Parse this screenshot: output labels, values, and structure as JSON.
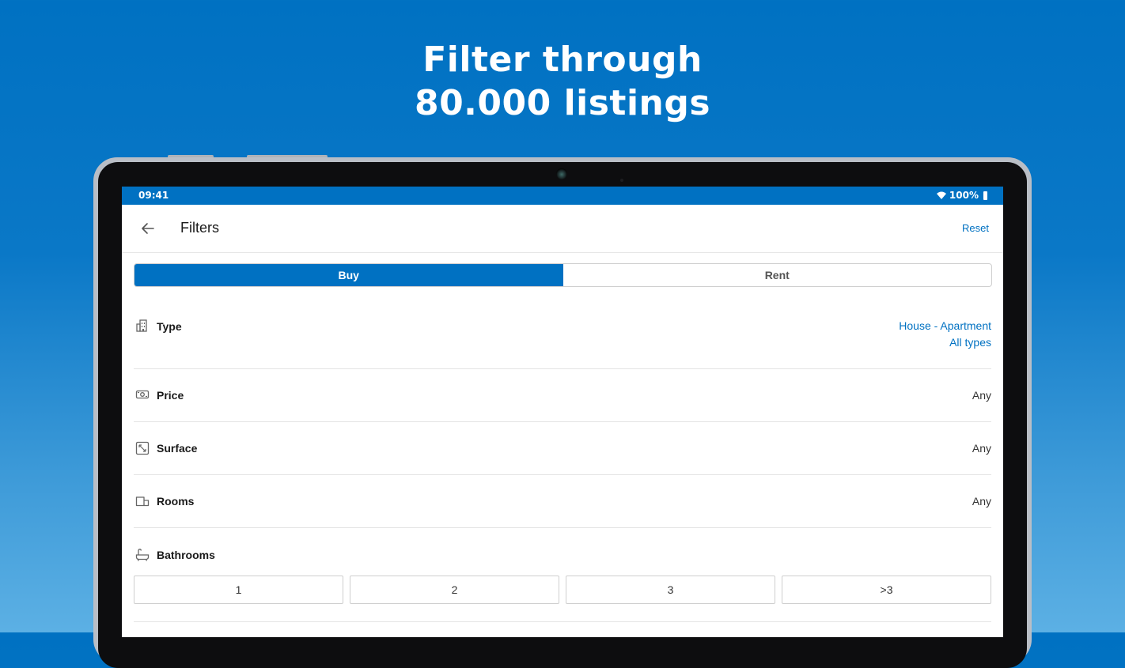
{
  "headline": {
    "line1": "Filter through",
    "line2": "80.000 listings"
  },
  "status_bar": {
    "time": "09:41",
    "battery": "100%"
  },
  "app_bar": {
    "title": "Filters",
    "reset": "Reset"
  },
  "segments": [
    {
      "label": "Buy",
      "selected": true
    },
    {
      "label": "Rent",
      "selected": false
    }
  ],
  "filters": {
    "type": {
      "label": "Type",
      "value_line1": "House - Apartment",
      "value_line2": "All types"
    },
    "price": {
      "label": "Price",
      "value": "Any"
    },
    "surface": {
      "label": "Surface",
      "value": "Any"
    },
    "rooms": {
      "label": "Rooms",
      "value": "Any"
    },
    "bathrooms": {
      "label": "Bathrooms",
      "options": [
        "1",
        "2",
        "3",
        ">3"
      ]
    }
  },
  "colors": {
    "brand": "#0071c2",
    "background_top": "#0071c2",
    "background_bottom": "#5cb0e4"
  },
  "icons": {
    "back": "arrow-left-icon",
    "type": "building-icon",
    "price": "banknote-icon",
    "surface": "resize-icon",
    "rooms": "room-icon",
    "bathrooms": "bathtub-icon"
  }
}
